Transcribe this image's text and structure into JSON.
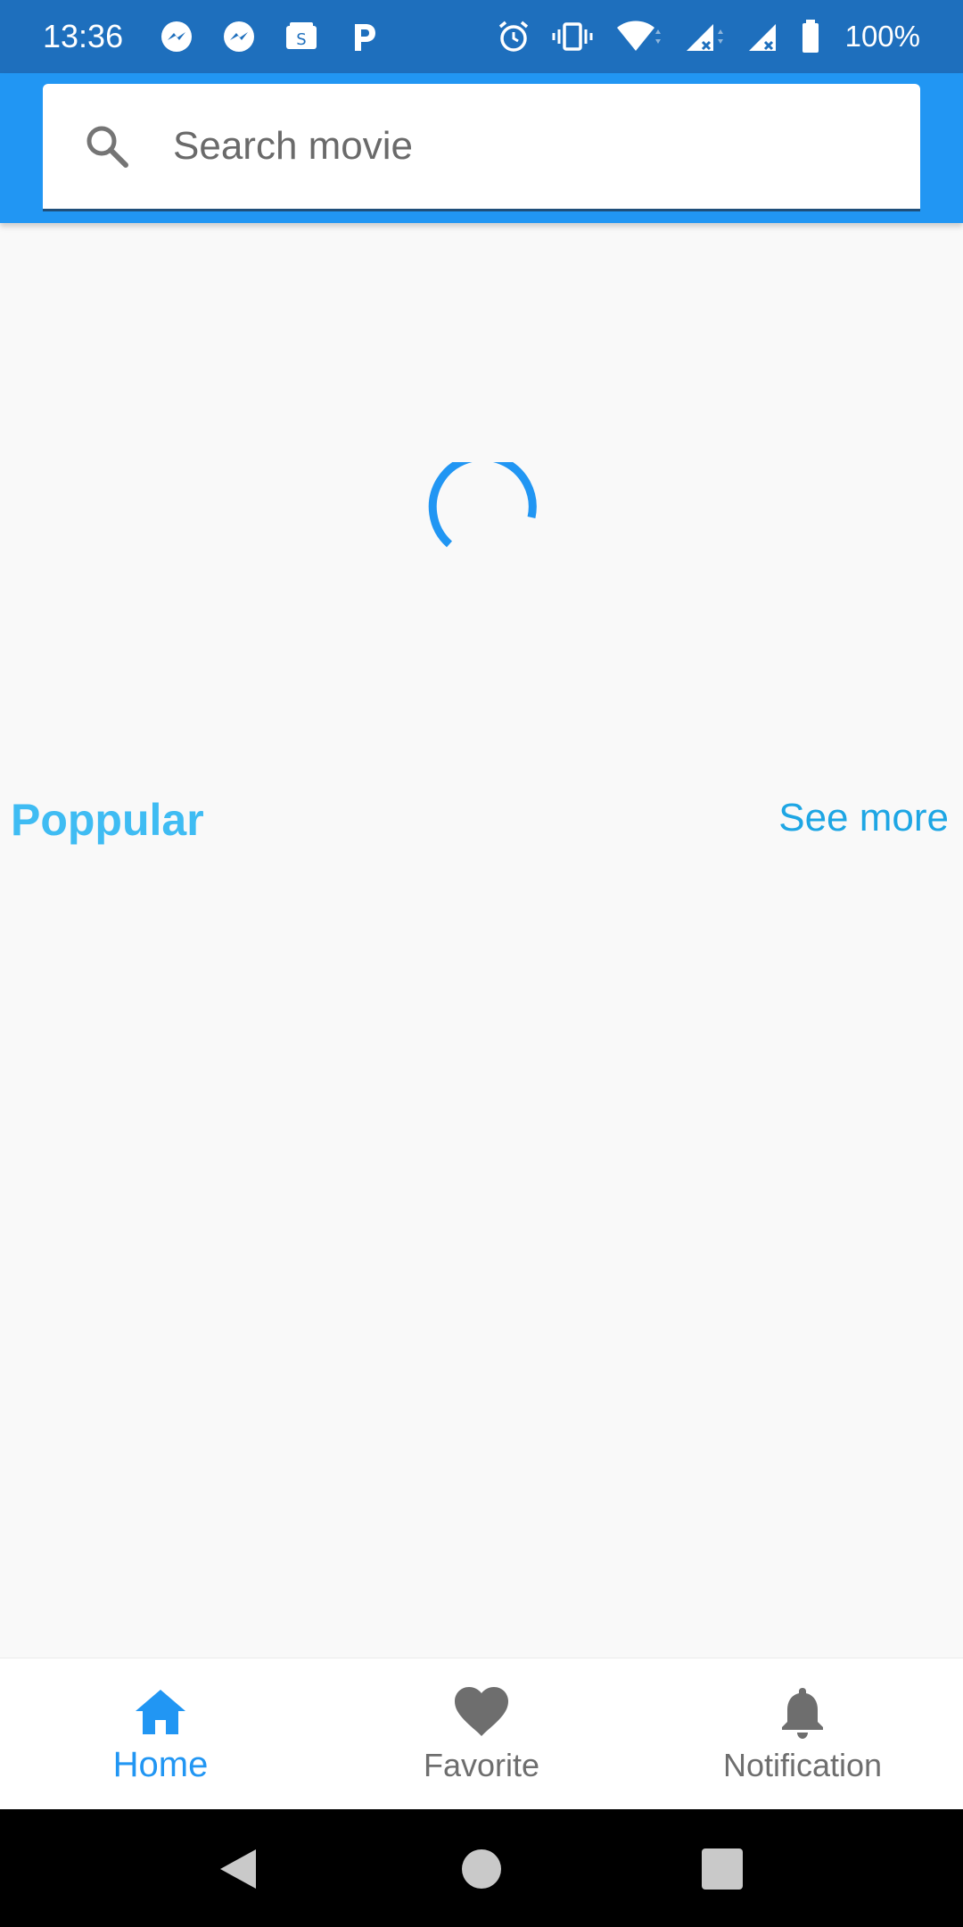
{
  "status_bar": {
    "time": "13:36",
    "battery": "100%",
    "icons_left": [
      "messenger-icon",
      "messenger-icon",
      "wallet-icon",
      "p-app-icon"
    ],
    "icons_right": [
      "alarm-icon",
      "vibrate-icon",
      "wifi-icon",
      "signal-icon",
      "signal-icon",
      "battery-icon"
    ]
  },
  "search": {
    "placeholder": "Search movie",
    "value": ""
  },
  "loading": {
    "indicator": "circular-progress"
  },
  "section": {
    "title": "Poppular",
    "see_more": "See more"
  },
  "bottom_nav": {
    "items": [
      {
        "label": "Home",
        "icon": "home-icon",
        "active": true
      },
      {
        "label": "Favorite",
        "icon": "heart-icon",
        "active": false
      },
      {
        "label": "Notification",
        "icon": "bell-icon",
        "active": false
      }
    ]
  },
  "colors": {
    "status_bar": "#1e6fbd",
    "app_bar": "#2196f3",
    "accent": "#2196f3",
    "section_title": "#3fbcf3",
    "see_more": "#1ea6e4",
    "inactive": "#6e6e6e",
    "background": "#f9f9f9"
  }
}
